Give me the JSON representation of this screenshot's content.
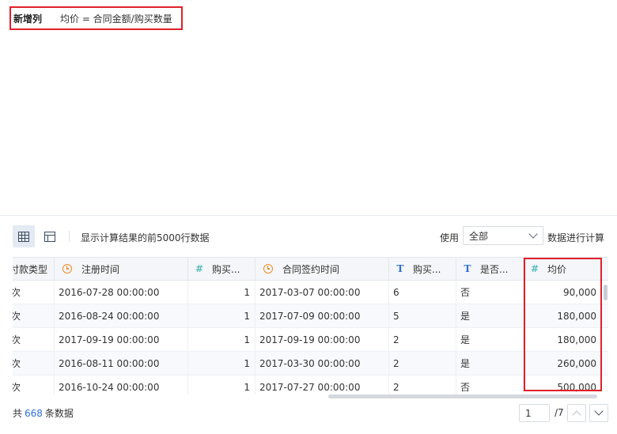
{
  "formula": {
    "name": "新增列",
    "expression": "均价 = 合同金额/购买数量"
  },
  "toolbar": {
    "info": "显示计算结果的前5000行数据",
    "use_label": "使用",
    "select_value": "全部",
    "use_suffix": "数据进行计算"
  },
  "table": {
    "headers": [
      "付款类型",
      "注册时间",
      "购买...",
      "合同签约时间",
      "购买...",
      "是否...",
      "均价"
    ],
    "header_icons": [
      "",
      "clock-icon",
      "hash-icon",
      "clock-icon",
      "text-type-icon",
      "text-type-icon",
      "hash-icon"
    ],
    "rows": [
      [
        "次",
        "2016-07-28 00:00:00",
        "1",
        "2017-03-07 00:00:00",
        "6",
        "否",
        "90,000"
      ],
      [
        "次",
        "2016-08-24 00:00:00",
        "1",
        "2017-07-09 00:00:00",
        "5",
        "是",
        "180,000"
      ],
      [
        "次",
        "2017-09-19 00:00:00",
        "1",
        "2017-09-19 00:00:00",
        "2",
        "是",
        "180,000"
      ],
      [
        "次",
        "2016-08-11 00:00:00",
        "1",
        "2017-03-30 00:00:00",
        "2",
        "是",
        "260,000"
      ],
      [
        "次",
        "2016-10-24 00:00:00",
        "1",
        "2017-07-27 00:00:00",
        "2",
        "否",
        "500,000"
      ]
    ]
  },
  "footer": {
    "prefix": "共",
    "count": "668",
    "suffix": "条数据",
    "page_value": "1",
    "page_total": "/7"
  },
  "colors": {
    "highlight": "#e0202a",
    "accent": "#2f6fd6"
  }
}
